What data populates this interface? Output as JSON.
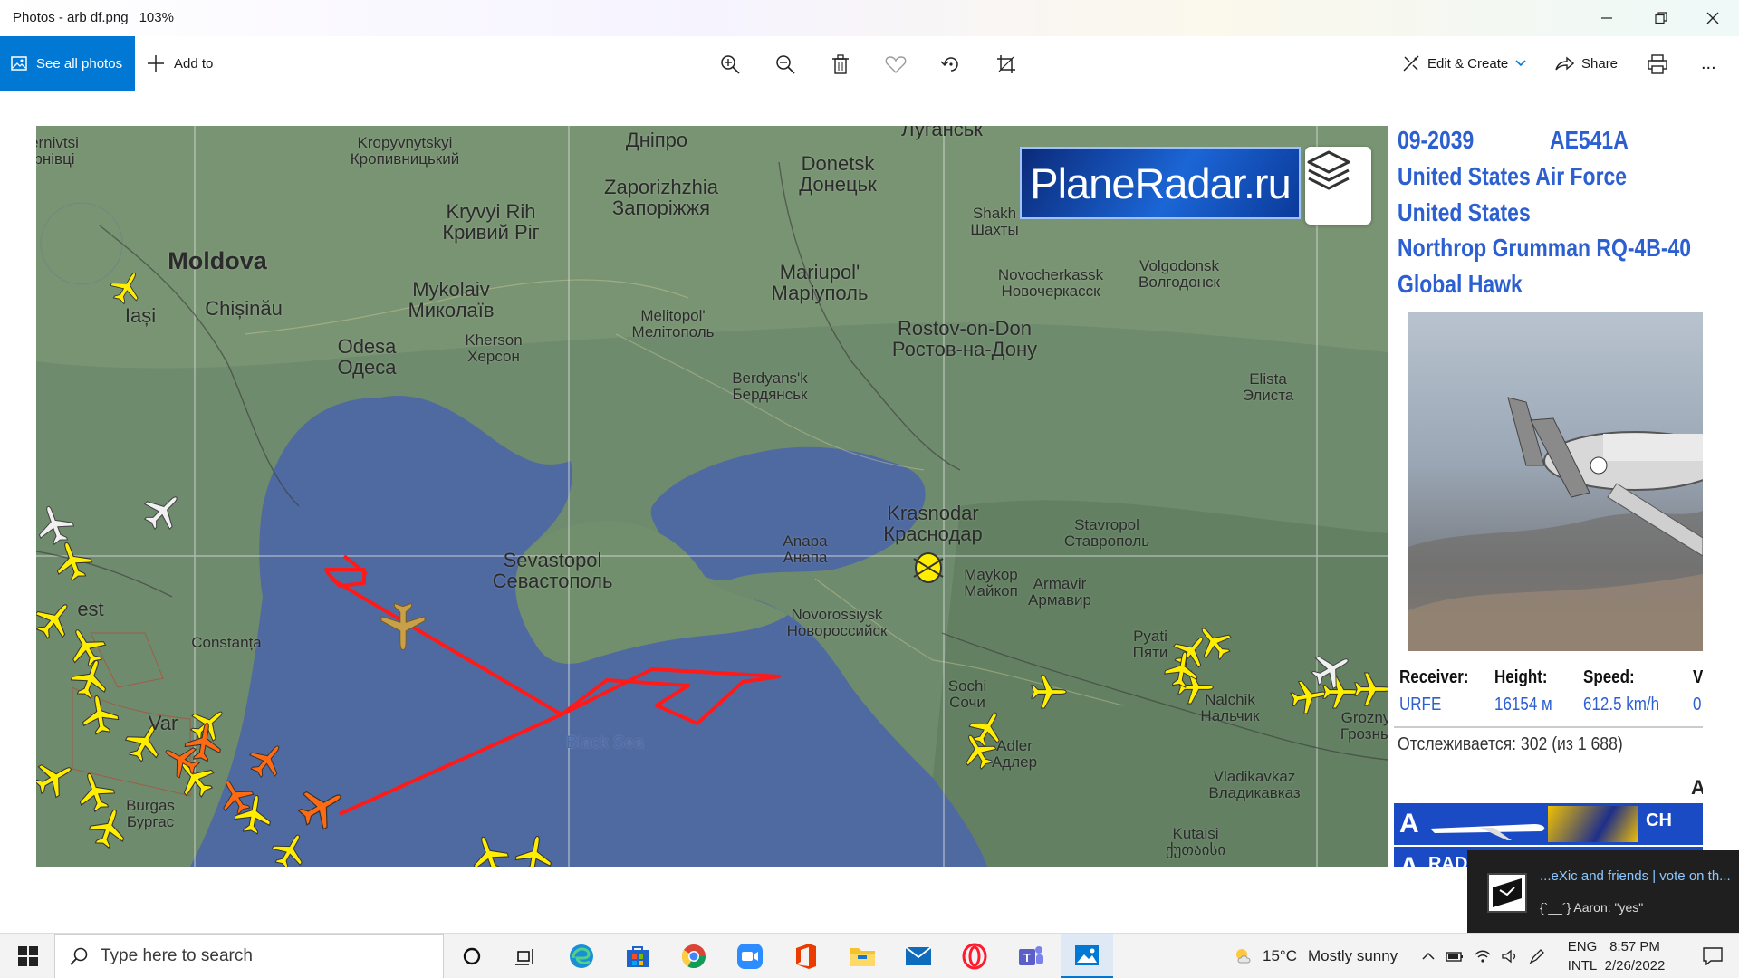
{
  "window": {
    "title": "Photos - arb df.png",
    "zoom": "103%"
  },
  "toolbar": {
    "see_all_photos": "See all photos",
    "add_to": "Add to",
    "edit_create": "Edit & Create",
    "share": "Share",
    "more": "..."
  },
  "map": {
    "brand": "PlaneRadar.ru",
    "labels": [
      {
        "text": "ernivtsi\nрнівці",
        "cls": "small"
      },
      {
        "text": "Kropyvnytskyi\nКропивницький",
        "cls": "small"
      },
      {
        "text": "Дніпро",
        "cls": ""
      },
      {
        "text": "Луганськ",
        "cls": ""
      },
      {
        "text": "Zaporizhzhia\nЗапоріжжя",
        "cls": ""
      },
      {
        "text": "Donetsk\nДонецьк",
        "cls": ""
      },
      {
        "text": "Moldova",
        "cls": "big"
      },
      {
        "text": "Kryvyi Rih\nКривий Ріг",
        "cls": ""
      },
      {
        "text": "Shakh\nШахты",
        "cls": "small"
      },
      {
        "text": "Chișinău",
        "cls": ""
      },
      {
        "text": "Iași",
        "cls": ""
      },
      {
        "text": "Mariupol'\nМаріуполь",
        "cls": ""
      },
      {
        "text": "Novocherkassk\nНовочеркасск",
        "cls": "small"
      },
      {
        "text": "Volgodonsk\nВолгодонск",
        "cls": "small"
      },
      {
        "text": "Mykolaiv\nМиколаїв",
        "cls": ""
      },
      {
        "text": "Melitopol'\nМелітополь",
        "cls": "small"
      },
      {
        "text": "Kherson\nХерсон",
        "cls": "small"
      },
      {
        "text": "Odesa\nОдеса",
        "cls": ""
      },
      {
        "text": "Rostov-on-Don\nРостов-на-Дону",
        "cls": ""
      },
      {
        "text": "Berdyans'k\nБердянськ",
        "cls": "small"
      },
      {
        "text": "Elista\nЭлиста",
        "cls": "small"
      },
      {
        "text": "Krasnodar\nКраснодар",
        "cls": ""
      },
      {
        "text": "Stavropol\nСтаврополь",
        "cls": "small"
      },
      {
        "text": "Sevastopol\nСевастополь",
        "cls": ""
      },
      {
        "text": "Anapa\nАнапа",
        "cls": "small"
      },
      {
        "text": "Maykop\nМайкоп",
        "cls": "small"
      },
      {
        "text": "Armavir\nАрмавир",
        "cls": "small"
      },
      {
        "text": "Novorossiysk\nНовороссийск",
        "cls": "small"
      },
      {
        "text": "Constanța",
        "cls": "small"
      },
      {
        "text": "Pyati\nПяти",
        "cls": "small"
      },
      {
        "text": "Sochi\nСочи",
        "cls": "small"
      },
      {
        "text": "Nalchik\nНальчик",
        "cls": "small"
      },
      {
        "text": "Grozny\nГрозны",
        "cls": "small"
      },
      {
        "text": "Black Sea",
        "cls": "sea"
      },
      {
        "text": "Adler\nАдлер",
        "cls": "small"
      },
      {
        "text": "Vladikavkaz\nВладикавказ",
        "cls": "small"
      },
      {
        "text": "Burgas\nБургас",
        "cls": "small"
      },
      {
        "text": "Kutaisi\nქუთაისი",
        "cls": "small"
      },
      {
        "text": "Var",
        "cls": ""
      },
      {
        "text": "est",
        "cls": ""
      }
    ]
  },
  "aircraft": {
    "registration": "09-2039",
    "hex": "AE541A",
    "operator": "United States Air Force",
    "country": "United States",
    "model_line1": "Northrop Grumman RQ-4B-40",
    "model_line2": "Global Hawk",
    "headers": {
      "receiver": "Receiver:",
      "height": "Height:",
      "speed": "Speed:",
      "v": "V"
    },
    "values": {
      "receiver": "URFE",
      "height": "16154 м",
      "speed": "612.5 km/h",
      "v": "0"
    },
    "tracking": "Отслеживается: 302 (из 1 688)",
    "air_label": "Air",
    "row1_letter": "A",
    "row1_code": "CH",
    "row2_letter": "A",
    "row2_code": "RAD"
  },
  "notification": {
    "title": "...eXic and friends | vote on th...",
    "body": "{`__´} Aaron: \"yes\""
  },
  "taskbar": {
    "search_placeholder": "Type here to search",
    "weather_temp": "15°C",
    "weather_text": "Mostly sunny",
    "lang_line1": "ENG",
    "lang_line2": "INTL",
    "time": "8:57 PM",
    "date": "2/26/2022"
  },
  "colors": {
    "accent": "#0078d4",
    "panel_title": "#2c5fd0",
    "flight_path": "#ff1a1a",
    "plane_yellow": "#ffee00",
    "plane_orange": "#ff6a13"
  }
}
